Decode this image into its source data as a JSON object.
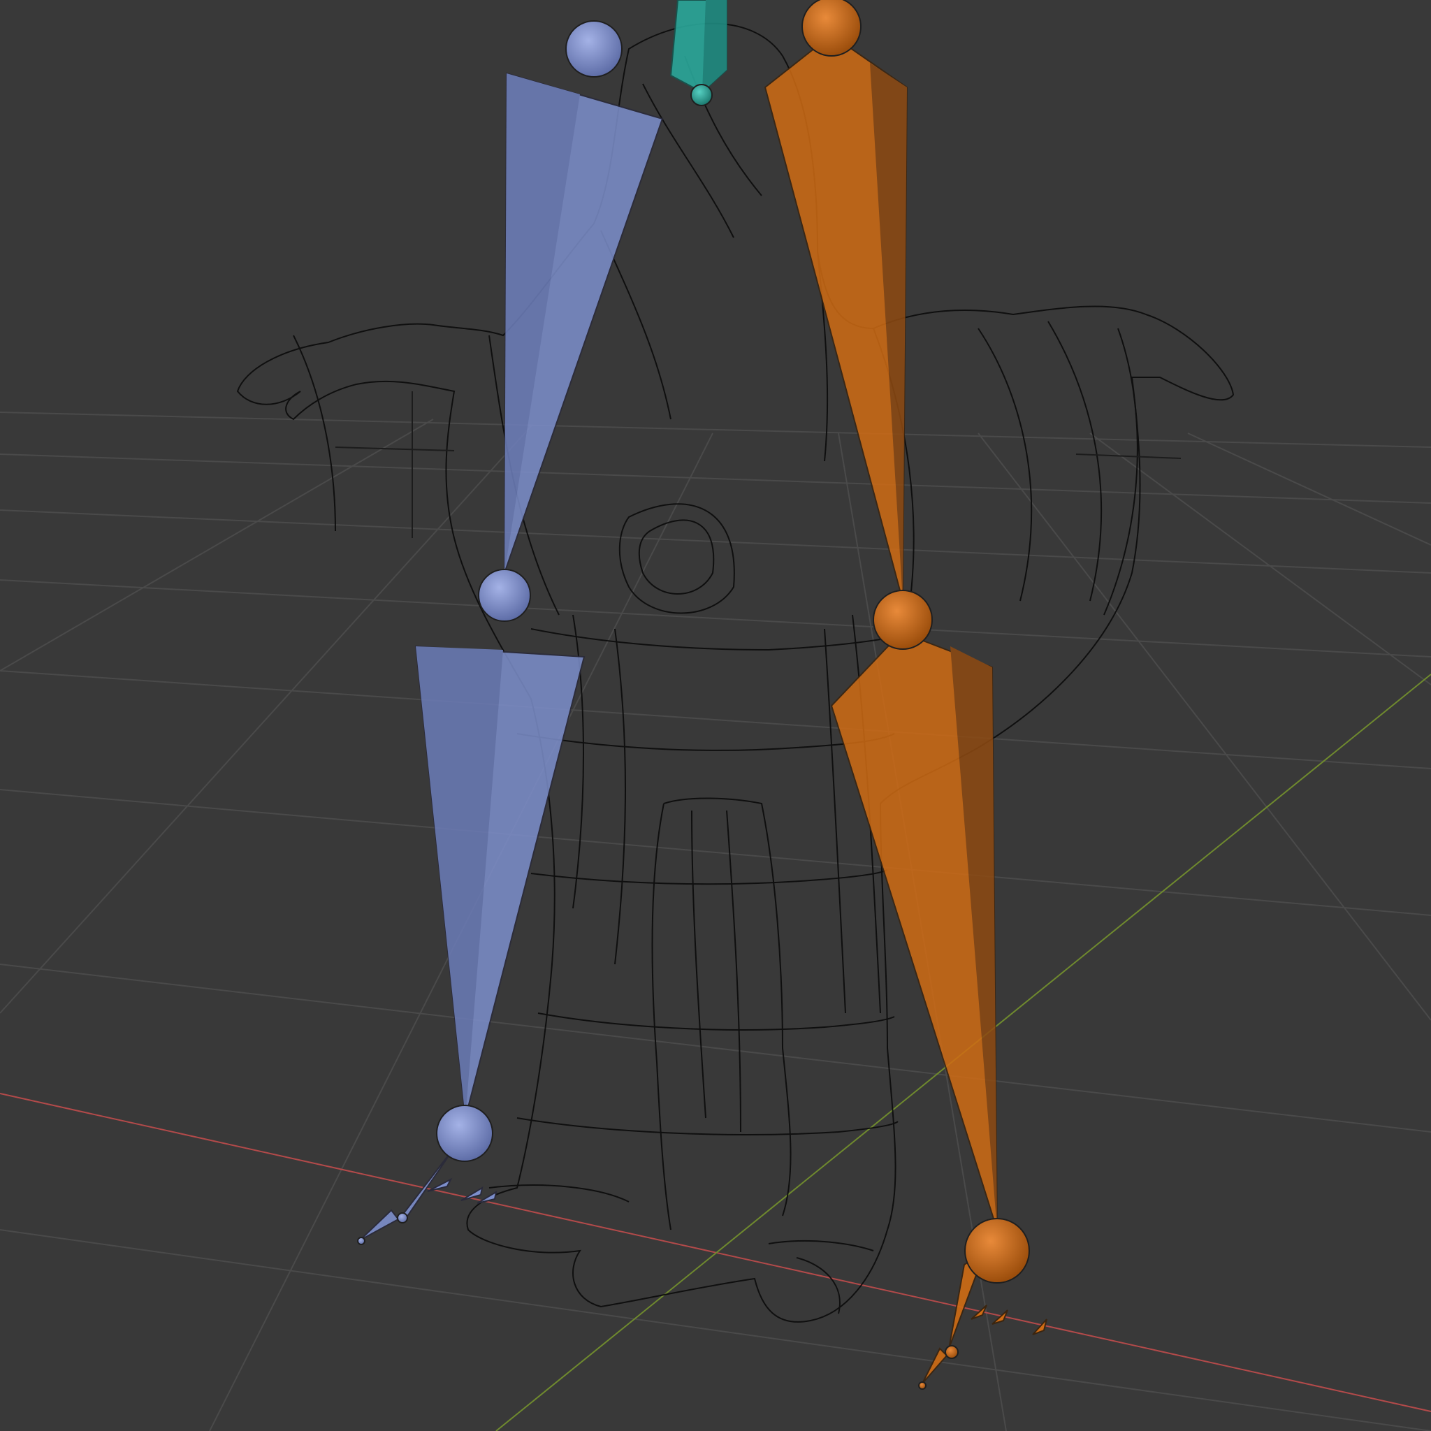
{
  "viewport": {
    "background": "#393939",
    "grid_color": "#4a4a4a",
    "axis_x_color": "#b34a4a",
    "axis_y_color": "#6f8a2e",
    "wire_color": "#0b0b0b"
  },
  "bones": {
    "left_color": "#7d8fcc",
    "right_color": "#d06c14",
    "center_color": "#2aa79a",
    "joint_outline": "#1f1f1f"
  }
}
